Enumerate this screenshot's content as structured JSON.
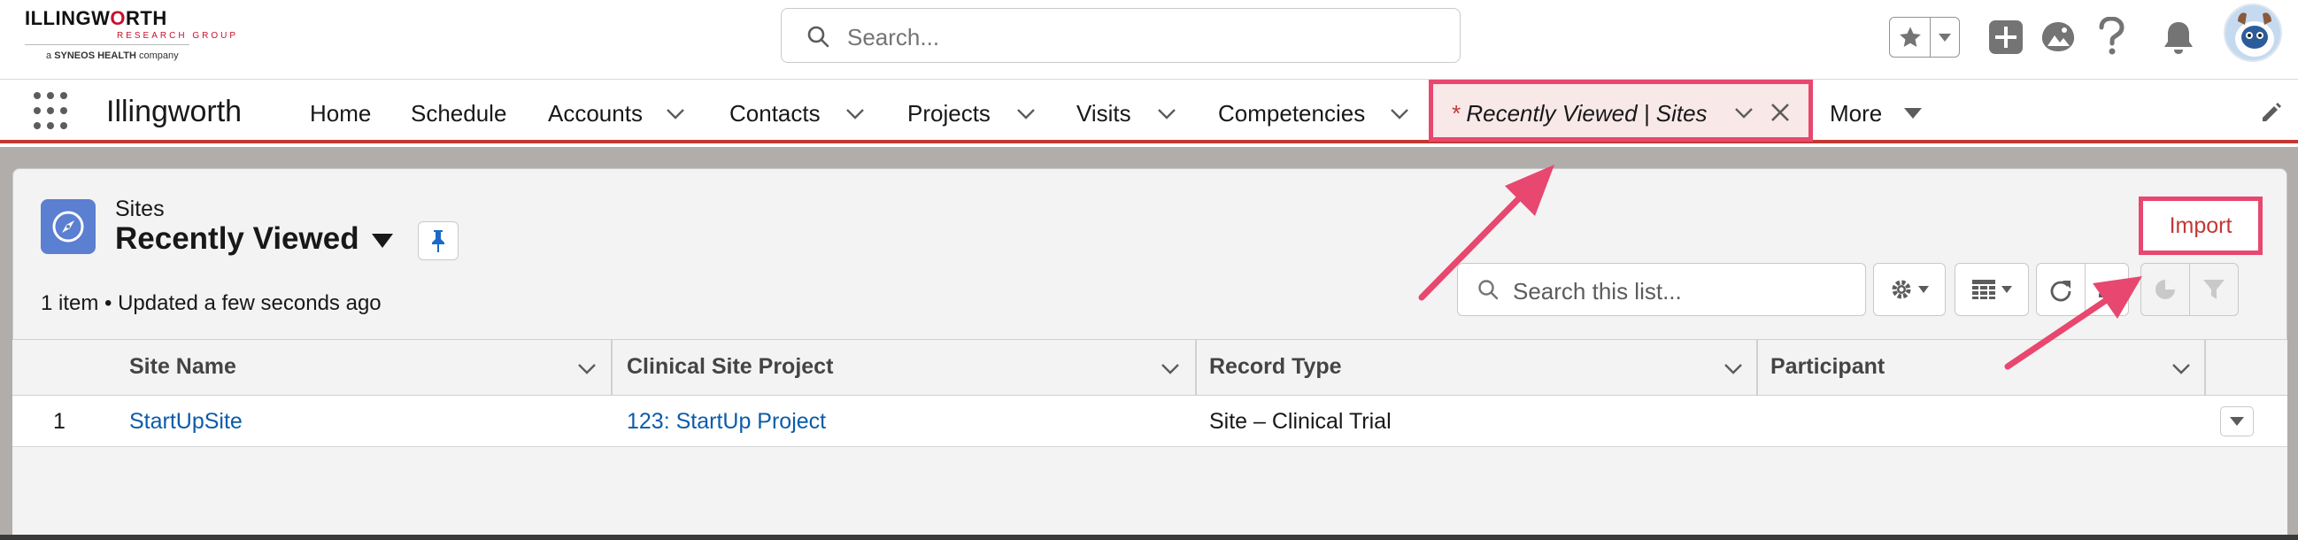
{
  "logo": {
    "brand_part1": "ILLINGW",
    "brand_o": "O",
    "brand_part2": "RTH",
    "tagline": "RESEARCH GROUP",
    "company_prefix": "a ",
    "company_bold": "SYNEOS HEALTH",
    "company_suffix": " company"
  },
  "header": {
    "search_placeholder": "Search...",
    "icons": [
      "star-icon",
      "chevron-down-icon",
      "add-icon",
      "trailhead-icon",
      "help-icon",
      "bell-icon",
      "avatar"
    ]
  },
  "nav": {
    "app_name": "Illingworth",
    "items": [
      {
        "label": "Home"
      },
      {
        "label": "Schedule"
      },
      {
        "label": "Accounts"
      },
      {
        "label": "Contacts"
      },
      {
        "label": "Projects"
      },
      {
        "label": "Visits"
      },
      {
        "label": "Competencies"
      }
    ],
    "active_tab": {
      "prefix": "* ",
      "label": "Recently Viewed | Sites"
    },
    "more_label": "More"
  },
  "list_view": {
    "object_label": "Sites",
    "title": "Recently Viewed",
    "meta": "1 item • Updated a few seconds ago",
    "import_label": "Import",
    "search_placeholder": "Search this list..."
  },
  "table": {
    "columns": [
      "Site Name",
      "Clinical Site Project",
      "Record Type",
      "Participant"
    ],
    "rows": [
      {
        "num": "1",
        "site_name": "StartUpSite",
        "clinical_site_project": "123: StartUp Project",
        "record_type": "Site – Clinical Trial",
        "participant": ""
      }
    ]
  },
  "colors": {
    "accent_red": "#c23934",
    "highlight_pink": "#e8476f",
    "link_blue": "#0b5cab",
    "object_icon_blue": "#5b7fd1"
  }
}
